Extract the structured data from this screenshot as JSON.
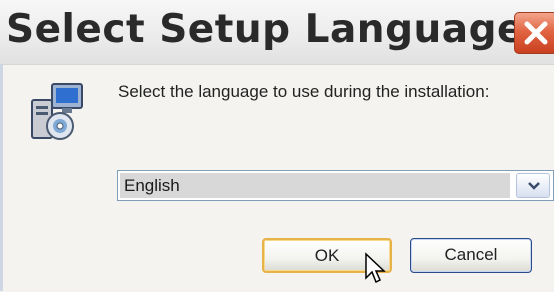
{
  "window": {
    "title": "Select Setup Language"
  },
  "dialog": {
    "prompt": "Select the language to use during the installation:",
    "language_select": {
      "selected": "English"
    },
    "buttons": {
      "ok_label": "OK",
      "cancel_label": "Cancel"
    }
  },
  "icons": {
    "close": "close-icon",
    "setup": "setup-computer-cd-icon",
    "dropdown": "chevron-down-icon",
    "cursor": "mouse-pointer-icon"
  },
  "colors": {
    "close_button": "#d9532f",
    "ok_border": "#e8b24a",
    "cancel_border": "#2a4a8a",
    "select_highlight": "#d8d8d8"
  }
}
